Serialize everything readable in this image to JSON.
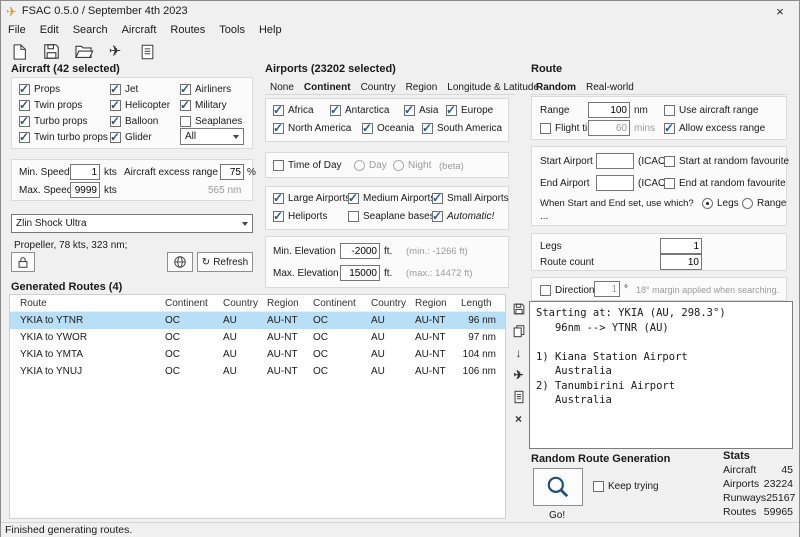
{
  "window": {
    "title": "FSAC 0.5.0 / September 4th 2023"
  },
  "icons": {
    "app": "✈",
    "close": "×",
    "refresh": "↻",
    "plane": "✈",
    "down": "↓",
    "clear": "×"
  },
  "menu": {
    "items": [
      "File",
      "Edit",
      "Search",
      "Aircraft",
      "Routes",
      "Tools",
      "Help"
    ]
  },
  "aircraft": {
    "title": "Aircraft (42 selected)",
    "types": [
      {
        "label": "Props",
        "checked": true
      },
      {
        "label": "Twin props",
        "checked": true
      },
      {
        "label": "Turbo props",
        "checked": true
      },
      {
        "label": "Twin turbo props",
        "checked": true
      },
      {
        "label": "Jet",
        "checked": true
      },
      {
        "label": "Helicopter",
        "checked": true
      },
      {
        "label": "Balloon",
        "checked": true
      },
      {
        "label": "Glider",
        "checked": true
      },
      {
        "label": "Airliners",
        "checked": true
      },
      {
        "label": "Military",
        "checked": true
      },
      {
        "label": "Seaplanes",
        "checked": false
      }
    ],
    "filter_dropdown": "All",
    "min_speed": {
      "label": "Min. Speed",
      "value": "1",
      "unit": "kts"
    },
    "max_speed": {
      "label": "Max. Speed",
      "value": "9999",
      "unit": "kts"
    },
    "excess_range": {
      "label": "Aircraft excess range",
      "value": "75",
      "unit": "%"
    },
    "range_hint": "565 nm",
    "selected": "Zlin Shock Ultra",
    "details": "Propeller, 78 kts, 323 nm;",
    "refresh_label": "Refresh"
  },
  "airports": {
    "title": "Airports (23202 selected)",
    "tabs": [
      "None",
      "Continent",
      "Country",
      "Region",
      "Longitude & Latitude"
    ],
    "active_tab": "Continent",
    "continents": [
      {
        "label": "Africa",
        "checked": true
      },
      {
        "label": "Antarctica",
        "checked": true
      },
      {
        "label": "Asia",
        "checked": true
      },
      {
        "label": "Europe",
        "checked": true
      },
      {
        "label": "North America",
        "checked": true
      },
      {
        "label": "Oceania",
        "checked": true
      },
      {
        "label": "South America",
        "checked": true
      }
    ],
    "time_of_day": {
      "label": "Time of Day",
      "checked": false,
      "day": "Day",
      "night": "Night",
      "beta": "(beta)"
    },
    "sizes": [
      {
        "label": "Large Airports",
        "checked": true
      },
      {
        "label": "Medium Airports",
        "checked": true
      },
      {
        "label": "Small Airports",
        "checked": true
      },
      {
        "label": "Heliports",
        "checked": true
      },
      {
        "label": "Seaplane bases",
        "checked": false
      },
      {
        "label": "Automatic!",
        "checked": true
      }
    ],
    "min_elevation": {
      "label": "Min. Elevation",
      "value": "-2000",
      "unit": "ft.",
      "hint": "(min.: -1266 ft)"
    },
    "max_elevation": {
      "label": "Max. Elevation",
      "value": "15000",
      "unit": "ft.",
      "hint": "(max.: 14472 ft)"
    }
  },
  "route": {
    "title": "Route",
    "tabs": [
      "Random",
      "Real-world"
    ],
    "active_tab": "Random",
    "range": {
      "label": "Range",
      "value": "100",
      "unit": "nm"
    },
    "use_aircraft_range": {
      "label": "Use aircraft range",
      "checked": false
    },
    "flight_time": {
      "label": "Flight time",
      "checked": false,
      "value": "60",
      "unit": "mins"
    },
    "allow_excess": {
      "label": "Allow excess range",
      "checked": true
    },
    "start": {
      "label": "Start Airport",
      "value": "",
      "hint": "(ICAO)",
      "fav_label": "Start at random favourite",
      "fav_checked": false
    },
    "end": {
      "label": "End Airport",
      "value": "",
      "hint": "(ICAO)",
      "fav_label": "End at random favourite",
      "fav_checked": false
    },
    "which": {
      "label": "When Start and End set, use which?",
      "legs": "Legs",
      "legs_selected": true,
      "range": "Range",
      "range_selected": false
    },
    "more": "...",
    "legs": {
      "label": "Legs",
      "value": "1"
    },
    "route_count": {
      "label": "Route count",
      "value": "10"
    },
    "direction": {
      "label": "Direction",
      "checked": false,
      "value": "1",
      "unit": "°",
      "hint": "18° margin applied when searching."
    }
  },
  "routes": {
    "title": "Generated Routes (4)",
    "headers": [
      "Route",
      "Continent",
      "Country",
      "Region",
      "Continent",
      "Country",
      "Region",
      "Length"
    ],
    "rows": [
      {
        "cells": [
          "YKIA to YTNR",
          "OC",
          "AU",
          "AU-NT",
          "OC",
          "AU",
          "AU-NT",
          "96 nm"
        ],
        "selected": true
      },
      {
        "cells": [
          "YKIA to YWOR",
          "OC",
          "AU",
          "AU-NT",
          "OC",
          "AU",
          "AU-NT",
          "97 nm"
        ],
        "selected": false
      },
      {
        "cells": [
          "YKIA to YMTA",
          "OC",
          "AU",
          "AU-NT",
          "OC",
          "AU",
          "AU-NT",
          "104 nm"
        ],
        "selected": false
      },
      {
        "cells": [
          "YKIA to YNUJ",
          "OC",
          "AU",
          "AU-NT",
          "OC",
          "AU",
          "AU-NT",
          "106 nm"
        ],
        "selected": false
      }
    ],
    "detail": "Starting at: YKIA (AU, 298.3°)\n   96nm --> YTNR (AU)\n\n1) Kiana Station Airport\n   Australia\n2) Tanumbirini Airport\n   Australia"
  },
  "generation": {
    "title": "Random Route Generation",
    "keep_trying": {
      "label": "Keep trying",
      "checked": false
    },
    "go_label": "Go!"
  },
  "stats": {
    "title": "Stats",
    "rows": [
      {
        "label": "Aircraft",
        "value": "45"
      },
      {
        "label": "Airports",
        "value": "23224"
      },
      {
        "label": "Runways",
        "value": "25167"
      },
      {
        "label": "Routes",
        "value": "59965"
      }
    ]
  },
  "status": {
    "text": "Finished generating routes."
  }
}
